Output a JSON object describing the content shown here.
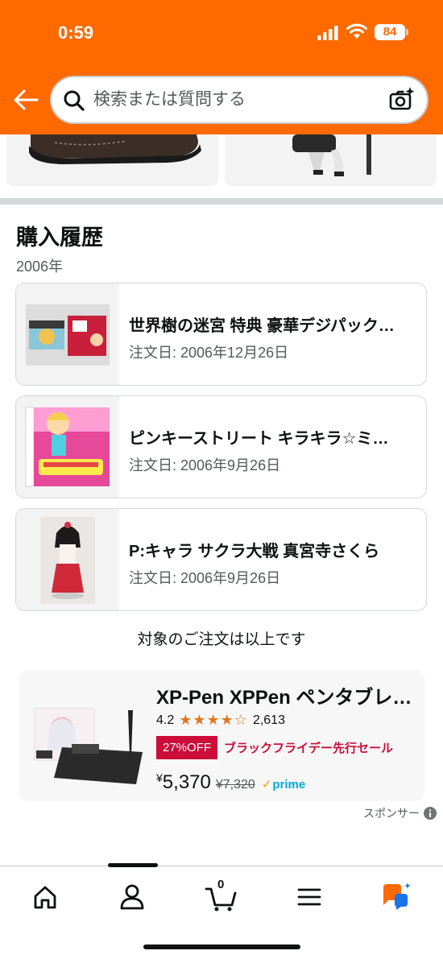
{
  "status": {
    "time": "0:59",
    "battery": "84"
  },
  "header": {
    "search_placeholder": "検索または質問する"
  },
  "history": {
    "title": "購入履歴",
    "year": "2006年",
    "orders": [
      {
        "title": "世界樹の迷宮 特典 豪華デジパック…",
        "date": "注文日: 2006年12月26日"
      },
      {
        "title": "ピンキーストリート キラキラ☆ミ…",
        "date": "注文日: 2006年9月26日"
      },
      {
        "title": "P:キャラ サクラ大戦 真宮寺さくら",
        "date": "注文日: 2006年9月26日"
      }
    ],
    "end_note": "対象のご注文は以上です"
  },
  "ad": {
    "title": "XP-Pen XPPen ペンタブレ…",
    "rating": "4.2",
    "stars": "★★★★☆",
    "reviews": "2,613",
    "deal_badge": "27%OFF",
    "deal_text": "ブラックフライデー先行セール",
    "price_symbol": "¥",
    "price": "5,370",
    "old_price": "¥7,320",
    "prime": "prime",
    "sponsor_label": "スポンサー"
  },
  "nav": {
    "cart_count": "0"
  },
  "colors": {
    "header_bg": "#fe6a00",
    "deal_red": "#cc0c39",
    "star_orange": "#de7921",
    "prime_blue": "#00a8e1"
  }
}
